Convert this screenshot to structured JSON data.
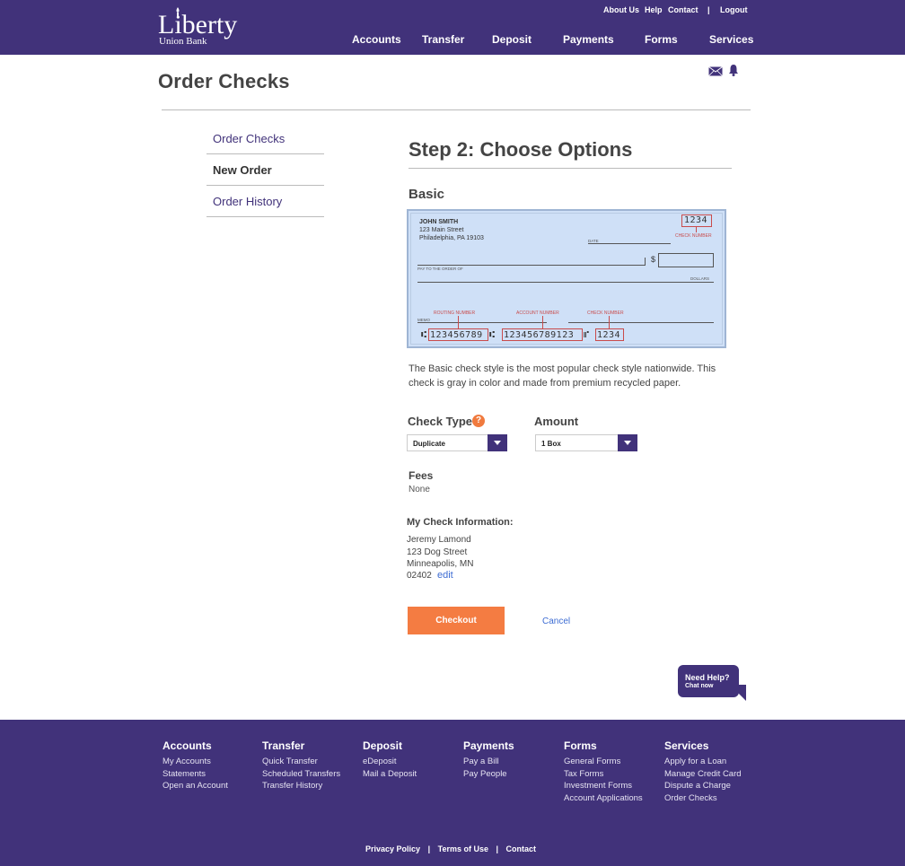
{
  "brand": {
    "name": "Liberty",
    "sub": "Union Bank"
  },
  "util_nav": [
    "About Us",
    "Help",
    "Contact",
    "|",
    "Logout"
  ],
  "main_nav": [
    "Accounts",
    "Transfer",
    "Deposit",
    "Payments",
    "Forms",
    "Services"
  ],
  "page_title": "Order Checks",
  "sidebar": [
    "Order Checks",
    "New Order",
    "Order History"
  ],
  "step_title": "Step 2: Choose Options",
  "check_style": "Basic",
  "check": {
    "name": "JOHN SMITH",
    "street": "123 Main Street",
    "city": "Philadelphia, PA 19103",
    "number": "1234",
    "check_number_label": "CHECK NUMBER",
    "date_label": "DATE",
    "pay_label": "PAY TO THE ORDER OF",
    "dollars_label": "DOLLARS",
    "memo_label": "MEMO",
    "routing_label": "ROUTING NUMBER",
    "account_label": "ACCOUNT NUMBER",
    "check_num_label2": "CHECK NUMBER",
    "routing": "123456789",
    "account": "123456789123",
    "micr_check": "1234",
    "dollar_sign": "$"
  },
  "description": "The Basic check style is the most popular check style nationwide.  This check is gray in color and made from premium recycled paper.",
  "check_type": {
    "label": "Check Type",
    "help": "?",
    "value": "Duplicate"
  },
  "amount": {
    "label": "Amount",
    "value": "1 Box"
  },
  "fees": {
    "label": "Fees",
    "value": "None"
  },
  "info": {
    "label": "My Check Information:",
    "name": "Jeremy Lamond",
    "street": "123 Dog Street",
    "city": "Minneapolis, MN",
    "zip": "02402",
    "edit": "edit"
  },
  "checkout": "Checkout",
  "cancel": "Cancel",
  "chat": {
    "line1": "Need Help?",
    "line2": "Chat now"
  },
  "footer": {
    "columns": [
      {
        "title": "Accounts",
        "links": [
          "My Accounts",
          "Statements",
          "Open an Account"
        ]
      },
      {
        "title": "Transfer",
        "links": [
          "Quick Transfer",
          "Scheduled Transfers",
          "Transfer History"
        ]
      },
      {
        "title": "Deposit",
        "links": [
          "eDeposit",
          "Mail a Deposit"
        ]
      },
      {
        "title": "Payments",
        "links": [
          "Pay a Bill",
          "Pay People"
        ]
      },
      {
        "title": "Forms",
        "links": [
          "General Forms",
          "Tax Forms",
          "Investment Forms",
          "Account Applications"
        ]
      },
      {
        "title": "Services",
        "links": [
          "Apply for a Loan",
          "Manage Credit Card",
          "Dispute a Charge",
          "Order Checks"
        ]
      }
    ],
    "legal": [
      "Privacy Policy",
      "|",
      "Terms of Use",
      "|",
      "Contact"
    ]
  },
  "colors": {
    "brand": "#41327a",
    "accent": "#f47c42",
    "link": "#3d6cd3"
  }
}
